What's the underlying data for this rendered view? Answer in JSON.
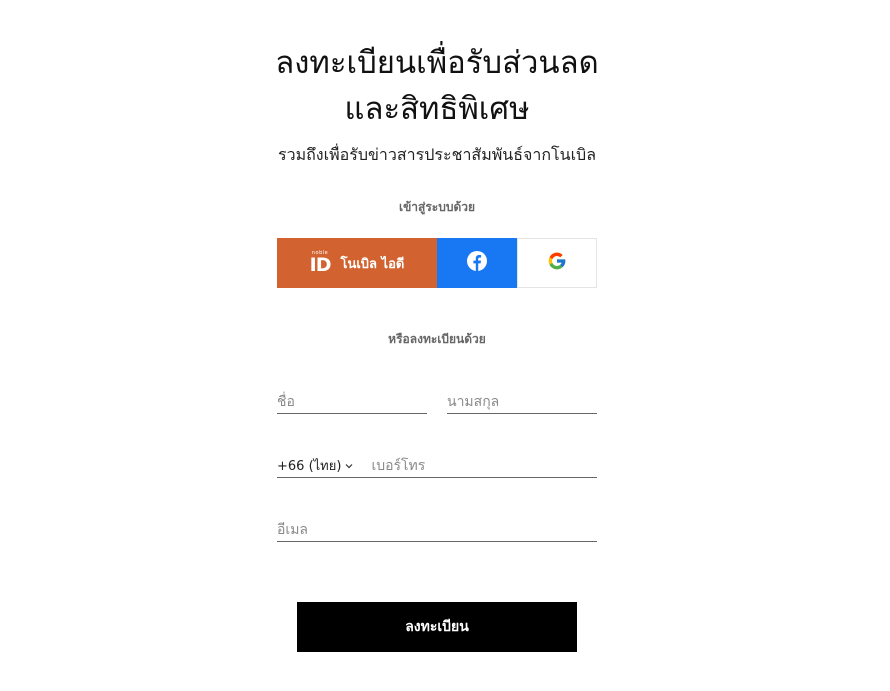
{
  "header": {
    "title_line1": "ลงทะเบียนเพื่อรับส่วนลด",
    "title_line2": "และสิทธิพิเศษ",
    "subtitle": "รวมถึงเพื่อรับข่าวสารประชาสัมพันธ์จากโนเบิล"
  },
  "social_login": {
    "label": "เข้าสู่ระบบด้วย",
    "noble_id": {
      "logo_small": "noble",
      "logo_big": "ID",
      "label": "โนเบิล ไอดี",
      "color": "#d2622f"
    },
    "facebook": {
      "icon": "facebook-icon",
      "color": "#1877f2"
    },
    "google": {
      "icon": "google-icon"
    }
  },
  "register": {
    "label": "หรือลงทะเบียนด้วย",
    "first_name_placeholder": "ชื่อ",
    "last_name_placeholder": "นามสกุล",
    "country_code": "+66 (ไทย)",
    "phone_placeholder": "เบอร์โทร",
    "email_placeholder": "อีเมล",
    "submit_label": "ลงทะเบียน"
  }
}
